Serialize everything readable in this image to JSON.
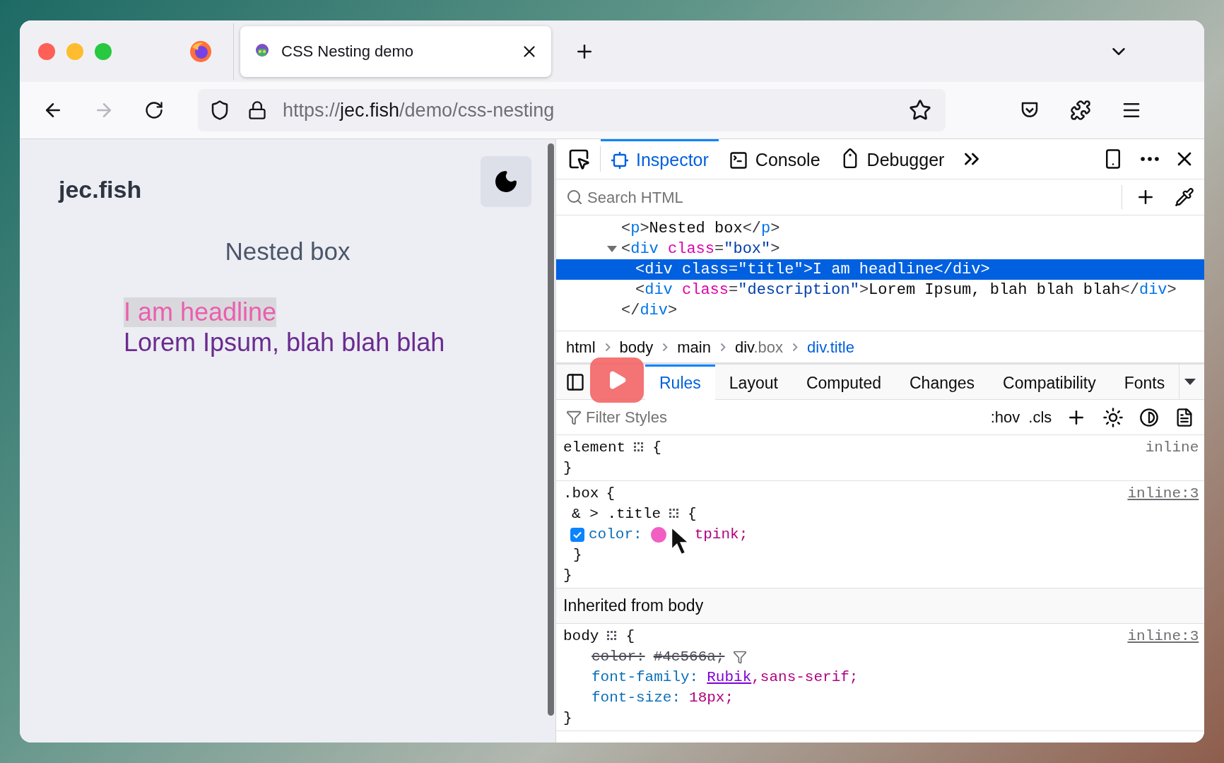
{
  "browser": {
    "tabs": [
      {
        "title": "CSS Nesting demo",
        "selected": true
      }
    ],
    "url": {
      "scheme": "https://",
      "host": "jec.fish",
      "path": "/demo/css-nesting"
    }
  },
  "page": {
    "site_title": "jec.fish",
    "heading": "Nested box",
    "headline": "I am headline",
    "headline_highlighted": true,
    "description": "Lorem Ipsum, blah blah blah"
  },
  "devtools": {
    "tools": [
      {
        "label": "Inspector",
        "selected": true
      },
      {
        "label": "Console",
        "selected": false
      },
      {
        "label": "Debugger",
        "selected": false
      }
    ],
    "search": {
      "placeholder": "Search HTML"
    },
    "markup": [
      {
        "selected": false,
        "tokens": [
          {
            "t": "<",
            "kind": "punct"
          },
          {
            "t": "p",
            "kind": "tag"
          },
          {
            "t": ">",
            "kind": "punct"
          },
          {
            "t": "Nested box",
            "kind": "text"
          },
          {
            "t": "</",
            "kind": "punct"
          },
          {
            "t": "p",
            "kind": "tag"
          },
          {
            "t": ">",
            "kind": "punct"
          }
        ]
      },
      {
        "selected": false,
        "expanded": true,
        "tokens": [
          {
            "t": "<",
            "kind": "punct"
          },
          {
            "t": "div",
            "kind": "tag"
          },
          {
            "t": " class",
            "kind": "attr"
          },
          {
            "t": "=",
            "kind": "punct"
          },
          {
            "t": "\"box\"",
            "kind": "val"
          },
          {
            "t": ">",
            "kind": "punct"
          }
        ],
        "children": [
          {
            "selected": true,
            "tokens": [
              {
                "t": "<",
                "kind": "punct"
              },
              {
                "t": "div",
                "kind": "tag"
              },
              {
                "t": " class",
                "kind": "attr"
              },
              {
                "t": "=",
                "kind": "punct"
              },
              {
                "t": "\"title\"",
                "kind": "val"
              },
              {
                "t": ">",
                "kind": "punct"
              },
              {
                "t": "I am headline",
                "kind": "text"
              },
              {
                "t": "</",
                "kind": "punct"
              },
              {
                "t": "div",
                "kind": "tag"
              },
              {
                "t": ">",
                "kind": "punct"
              }
            ]
          },
          {
            "selected": false,
            "tokens": [
              {
                "t": "<",
                "kind": "punct"
              },
              {
                "t": "div",
                "kind": "tag"
              },
              {
                "t": " class",
                "kind": "attr"
              },
              {
                "t": "=",
                "kind": "punct"
              },
              {
                "t": "\"description\"",
                "kind": "val"
              },
              {
                "t": ">",
                "kind": "punct"
              },
              {
                "t": "Lorem Ipsum, blah blah blah",
                "kind": "text"
              },
              {
                "t": "</",
                "kind": "punct"
              },
              {
                "t": "div",
                "kind": "tag"
              },
              {
                "t": ">",
                "kind": "punct"
              }
            ]
          }
        ]
      },
      {
        "selected": false,
        "tokens": [
          {
            "t": "</",
            "kind": "punct"
          },
          {
            "t": "div",
            "kind": "tag"
          },
          {
            "t": ">",
            "kind": "punct"
          }
        ]
      }
    ],
    "breadcrumbs": [
      {
        "tag": "html",
        "selected": false
      },
      {
        "tag": "body",
        "selected": false
      },
      {
        "tag": "main",
        "selected": false
      },
      {
        "tag": "div",
        "class": ".box",
        "selected": false
      },
      {
        "tag": "div",
        "class": ".title",
        "selected": true
      }
    ],
    "panel_tabs": [
      {
        "label": "Rules",
        "selected": true
      },
      {
        "label": "Layout",
        "selected": false
      },
      {
        "label": "Computed",
        "selected": false
      },
      {
        "label": "Changes",
        "selected": false
      },
      {
        "label": "Compatibility",
        "selected": false
      },
      {
        "label": "Fonts",
        "selected": false
      }
    ],
    "filter": {
      "placeholder": "Filter Styles",
      "buttons": [
        ":hov",
        ".cls"
      ]
    },
    "sections": [
      {
        "kind": "rule",
        "source": "inline",
        "source_link": false,
        "lines": [
          {
            "kind": "selector",
            "text": "element",
            "grid": true,
            "brace": "{"
          },
          {
            "kind": "close",
            "text": "}"
          }
        ]
      },
      {
        "kind": "rule",
        "source": "inline:3",
        "source_link": true,
        "lines": [
          {
            "kind": "selector",
            "text": ".box",
            "grid": false,
            "brace": "{"
          },
          {
            "kind": "nested_selector",
            "text": "& > .title",
            "grid": true,
            "brace": "{"
          },
          {
            "kind": "nested_decl",
            "property": "color:",
            "value": "tpink;",
            "checked": true,
            "color": "#f25fc3",
            "cursor": true,
            "overridden": false
          },
          {
            "kind": "nested_close",
            "text": "}"
          },
          {
            "kind": "close",
            "text": "}"
          }
        ]
      },
      {
        "kind": "header",
        "text": "Inherited from body"
      },
      {
        "kind": "rule",
        "source": "inline:3",
        "source_link": true,
        "lines": [
          {
            "kind": "selector",
            "text": "body",
            "grid": true,
            "brace": "{"
          },
          {
            "kind": "decl",
            "property": "color:",
            "value": "#4c566a;",
            "overridden": true
          },
          {
            "kind": "decl",
            "property": "font-family:",
            "link": "Rubik",
            "value": ",sans-serif;",
            "overridden": false
          },
          {
            "kind": "decl",
            "property": "font-size:",
            "value": "18px;",
            "overridden": false
          },
          {
            "kind": "close",
            "text": "}"
          }
        ]
      }
    ]
  }
}
